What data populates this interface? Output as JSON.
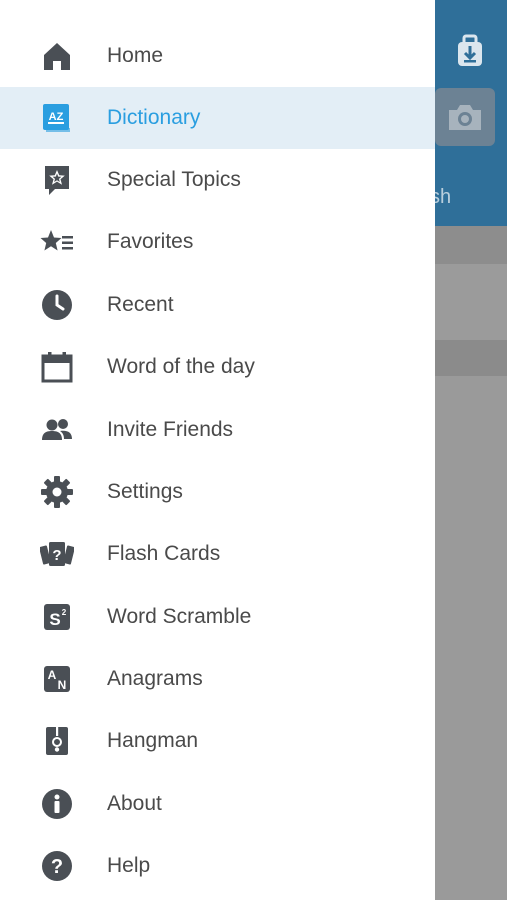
{
  "background": {
    "partial_text": "sh",
    "download_icon": "download-icon",
    "camera_icon": "camera-icon",
    "header_color": "#2f6f99"
  },
  "menu": {
    "items": [
      {
        "label": "Home",
        "icon": "home-icon"
      },
      {
        "label": "Dictionary",
        "icon": "dictionary-az-icon",
        "active": true
      },
      {
        "label": "Special Topics",
        "icon": "special-topics-icon"
      },
      {
        "label": "Favorites",
        "icon": "favorites-icon"
      },
      {
        "label": "Recent",
        "icon": "clock-icon"
      },
      {
        "label": "Word of the day",
        "icon": "calendar-icon"
      },
      {
        "label": "Invite Friends",
        "icon": "people-icon"
      },
      {
        "label": "Settings",
        "icon": "gear-icon"
      },
      {
        "label": "Flash Cards",
        "icon": "flash-cards-icon"
      },
      {
        "label": "Word Scramble",
        "icon": "word-scramble-icon"
      },
      {
        "label": "Anagrams",
        "icon": "anagrams-icon"
      },
      {
        "label": "Hangman",
        "icon": "hangman-icon"
      },
      {
        "label": "About",
        "icon": "info-icon"
      },
      {
        "label": "Help",
        "icon": "help-icon"
      }
    ]
  },
  "colors": {
    "icon": "#4a4f55",
    "active_text": "#2a9ee0",
    "active_bg": "#e3eef6"
  }
}
